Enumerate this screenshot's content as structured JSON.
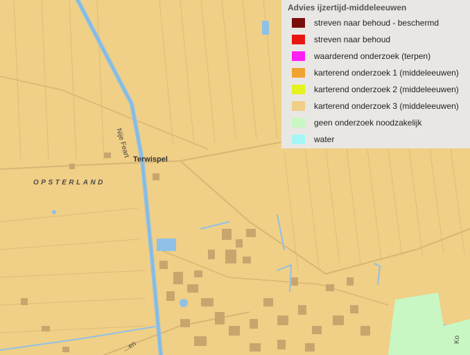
{
  "legend": {
    "title": "Advies ijzertijd-middeleeuwen",
    "items": [
      {
        "label": "streven naar behoud - beschermd",
        "color": "#7a0d0d"
      },
      {
        "label": "streven naar behoud",
        "color": "#e81512"
      },
      {
        "label": "waarderend onderzoek (terpen)",
        "color": "#ff1ff5"
      },
      {
        "label": "karterend onderzoek 1 (middeleeuwen)",
        "color": "#f0a430"
      },
      {
        "label": "karterend onderzoek 2 (middeleeuwen)",
        "color": "#e4f21e"
      },
      {
        "label": "karterend onderzoek 3 (middeleeuwen)",
        "color": "#f0cf86"
      },
      {
        "label": "geen onderzoek noodzakelijk",
        "color": "#c8f7c3"
      },
      {
        "label": "water",
        "color": "#a4f6f6"
      }
    ]
  },
  "map": {
    "places": {
      "terwispel": "Terwispel",
      "opsterland": "OPSTERLAND"
    },
    "roads": {
      "nije_feart": "Nije Feart",
      "sw": "...en",
      "se": "Ko"
    },
    "colors": {
      "background": "#f0cf86",
      "water": "#8fc1e6",
      "buildings": "#c9a56e",
      "parcels": "#dcbb78",
      "green_zone": "#c8f7c3"
    }
  }
}
